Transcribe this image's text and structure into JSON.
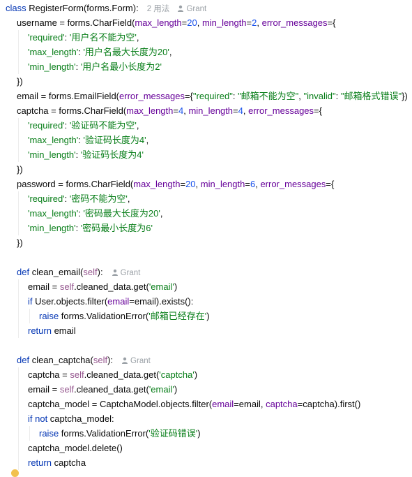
{
  "hints": {
    "class_usages": "2 用法",
    "author": "Grant"
  },
  "code_lines": [
    {
      "indent": 0,
      "hint": "class_usages",
      "tokens": [
        [
          "kw",
          "class "
        ],
        [
          "",
          "RegisterForm(forms.Form):"
        ]
      ]
    },
    {
      "indent": 1,
      "tokens": [
        [
          "",
          "username = forms.CharField("
        ],
        [
          "named",
          "max_length"
        ],
        [
          "",
          "="
        ],
        [
          "num",
          "20"
        ],
        [
          "",
          ", "
        ],
        [
          "named",
          "min_length"
        ],
        [
          "",
          "="
        ],
        [
          "num",
          "2"
        ],
        [
          "",
          ", "
        ],
        [
          "named",
          "error_messages"
        ],
        [
          "",
          "={"
        ]
      ]
    },
    {
      "indent": 2,
      "tokens": [
        [
          "str",
          "'required'"
        ],
        [
          "",
          ": "
        ],
        [
          "str",
          "'用户名不能为空'"
        ],
        [
          "",
          ","
        ]
      ]
    },
    {
      "indent": 2,
      "tokens": [
        [
          "str",
          "'max_length'"
        ],
        [
          "",
          ": "
        ],
        [
          "str",
          "'用户名最大长度为20'"
        ],
        [
          "",
          ","
        ]
      ]
    },
    {
      "indent": 2,
      "tokens": [
        [
          "str",
          "'min_length'"
        ],
        [
          "",
          ": "
        ],
        [
          "str",
          "'用户名最小长度为2'"
        ]
      ]
    },
    {
      "indent": 1,
      "tokens": [
        [
          "",
          "})"
        ]
      ]
    },
    {
      "indent": 1,
      "tokens": [
        [
          "",
          "email = forms.EmailField("
        ],
        [
          "named",
          "error_messages"
        ],
        [
          "",
          "={"
        ],
        [
          "str",
          "\"required\""
        ],
        [
          "",
          ": "
        ],
        [
          "str",
          "\"邮箱不能为空\""
        ],
        [
          "",
          ", "
        ],
        [
          "str",
          "\"invalid\""
        ],
        [
          "",
          ": "
        ],
        [
          "str",
          "\"邮箱格式错误\""
        ],
        [
          "",
          "})"
        ]
      ]
    },
    {
      "indent": 1,
      "tokens": [
        [
          "",
          "captcha = forms.CharField("
        ],
        [
          "named",
          "max_length"
        ],
        [
          "",
          "="
        ],
        [
          "num",
          "4"
        ],
        [
          "",
          ", "
        ],
        [
          "named",
          "min_length"
        ],
        [
          "",
          "="
        ],
        [
          "num",
          "4"
        ],
        [
          "",
          ", "
        ],
        [
          "named",
          "error_messages"
        ],
        [
          "",
          "={"
        ]
      ]
    },
    {
      "indent": 2,
      "tokens": [
        [
          "str",
          "'required'"
        ],
        [
          "",
          ": "
        ],
        [
          "str",
          "'验证码不能为空'"
        ],
        [
          "",
          ","
        ]
      ]
    },
    {
      "indent": 2,
      "tokens": [
        [
          "str",
          "'max_length'"
        ],
        [
          "",
          ": "
        ],
        [
          "str",
          "'验证码长度为4'"
        ],
        [
          "",
          ","
        ]
      ]
    },
    {
      "indent": 2,
      "tokens": [
        [
          "str",
          "'min_length'"
        ],
        [
          "",
          ": "
        ],
        [
          "str",
          "'验证码长度为4'"
        ]
      ]
    },
    {
      "indent": 1,
      "tokens": [
        [
          "",
          "})"
        ]
      ]
    },
    {
      "indent": 1,
      "tokens": [
        [
          "",
          "password = forms.CharField("
        ],
        [
          "named",
          "max_length"
        ],
        [
          "",
          "="
        ],
        [
          "num",
          "20"
        ],
        [
          "",
          ", "
        ],
        [
          "named",
          "min_length"
        ],
        [
          "",
          "="
        ],
        [
          "num",
          "6"
        ],
        [
          "",
          ", "
        ],
        [
          "named",
          "error_messages"
        ],
        [
          "",
          "={"
        ]
      ]
    },
    {
      "indent": 2,
      "tokens": [
        [
          "str",
          "'required'"
        ],
        [
          "",
          ": "
        ],
        [
          "str",
          "'密码不能为空'"
        ],
        [
          "",
          ","
        ]
      ]
    },
    {
      "indent": 2,
      "tokens": [
        [
          "str",
          "'max_length'"
        ],
        [
          "",
          ": "
        ],
        [
          "str",
          "'密码最大长度为20'"
        ],
        [
          "",
          ","
        ]
      ]
    },
    {
      "indent": 2,
      "tokens": [
        [
          "str",
          "'min_length'"
        ],
        [
          "",
          ": "
        ],
        [
          "str",
          "'密码最小长度为6'"
        ]
      ]
    },
    {
      "indent": 1,
      "tokens": [
        [
          "",
          "})"
        ]
      ]
    },
    {
      "indent": 0,
      "tokens": []
    },
    {
      "indent": 1,
      "hint": "author_only",
      "tokens": [
        [
          "kw",
          "def "
        ],
        [
          "",
          "clean_email("
        ],
        [
          "sf",
          "self"
        ],
        [
          "",
          "):"
        ]
      ]
    },
    {
      "indent": 2,
      "tokens": [
        [
          "",
          "email = "
        ],
        [
          "sf",
          "self"
        ],
        [
          "",
          ".cleaned_data.get("
        ],
        [
          "str",
          "'email'"
        ],
        [
          "",
          ")"
        ]
      ]
    },
    {
      "indent": 2,
      "tokens": [
        [
          "kw",
          "if "
        ],
        [
          "",
          "User.objects.filter("
        ],
        [
          "named",
          "email"
        ],
        [
          "",
          "=email).exists():"
        ]
      ]
    },
    {
      "indent": 3,
      "tokens": [
        [
          "kw",
          "raise "
        ],
        [
          "",
          "forms.ValidationError("
        ],
        [
          "str",
          "'邮箱已经存在'"
        ],
        [
          "",
          ")"
        ]
      ]
    },
    {
      "indent": 2,
      "tokens": [
        [
          "kw",
          "return "
        ],
        [
          "",
          "email"
        ]
      ]
    },
    {
      "indent": 0,
      "tokens": []
    },
    {
      "indent": 1,
      "hint": "author_only",
      "tokens": [
        [
          "kw",
          "def "
        ],
        [
          "",
          "clean_captcha("
        ],
        [
          "sf",
          "self"
        ],
        [
          "",
          "):"
        ]
      ]
    },
    {
      "indent": 2,
      "tokens": [
        [
          "",
          "captcha = "
        ],
        [
          "sf",
          "self"
        ],
        [
          "",
          ".cleaned_data.get("
        ],
        [
          "str",
          "'captcha'"
        ],
        [
          "",
          ")"
        ]
      ]
    },
    {
      "indent": 2,
      "tokens": [
        [
          "",
          "email = "
        ],
        [
          "sf",
          "self"
        ],
        [
          "",
          ".cleaned_data.get("
        ],
        [
          "str",
          "'email'"
        ],
        [
          "",
          ")"
        ]
      ]
    },
    {
      "indent": 2,
      "tokens": [
        [
          "",
          "captcha_model = CaptchaModel.objects.filter("
        ],
        [
          "named",
          "email"
        ],
        [
          "",
          "=email, "
        ],
        [
          "named",
          "captcha"
        ],
        [
          "",
          "=captcha).first()"
        ]
      ]
    },
    {
      "indent": 2,
      "tokens": [
        [
          "kw",
          "if not "
        ],
        [
          "",
          "captcha_model:"
        ]
      ]
    },
    {
      "indent": 3,
      "tokens": [
        [
          "kw",
          "raise "
        ],
        [
          "",
          "forms.ValidationError("
        ],
        [
          "str",
          "'验证码错误'"
        ],
        [
          "",
          ")"
        ]
      ]
    },
    {
      "indent": 2,
      "tokens": [
        [
          "",
          "captcha_model.delete()"
        ]
      ]
    },
    {
      "indent": 2,
      "tokens": [
        [
          "kw",
          "return "
        ],
        [
          "",
          "captcha"
        ]
      ]
    }
  ],
  "colors": {
    "keyword": "#0033b3",
    "number": "#1750eb",
    "string": "#067d17",
    "self": "#94558d",
    "named_arg": "#660099",
    "hint": "#9aa0a6",
    "bulb": "#f2c14e"
  },
  "icons": {
    "author_hint": "person-icon",
    "gutter": "lightbulb-icon"
  }
}
